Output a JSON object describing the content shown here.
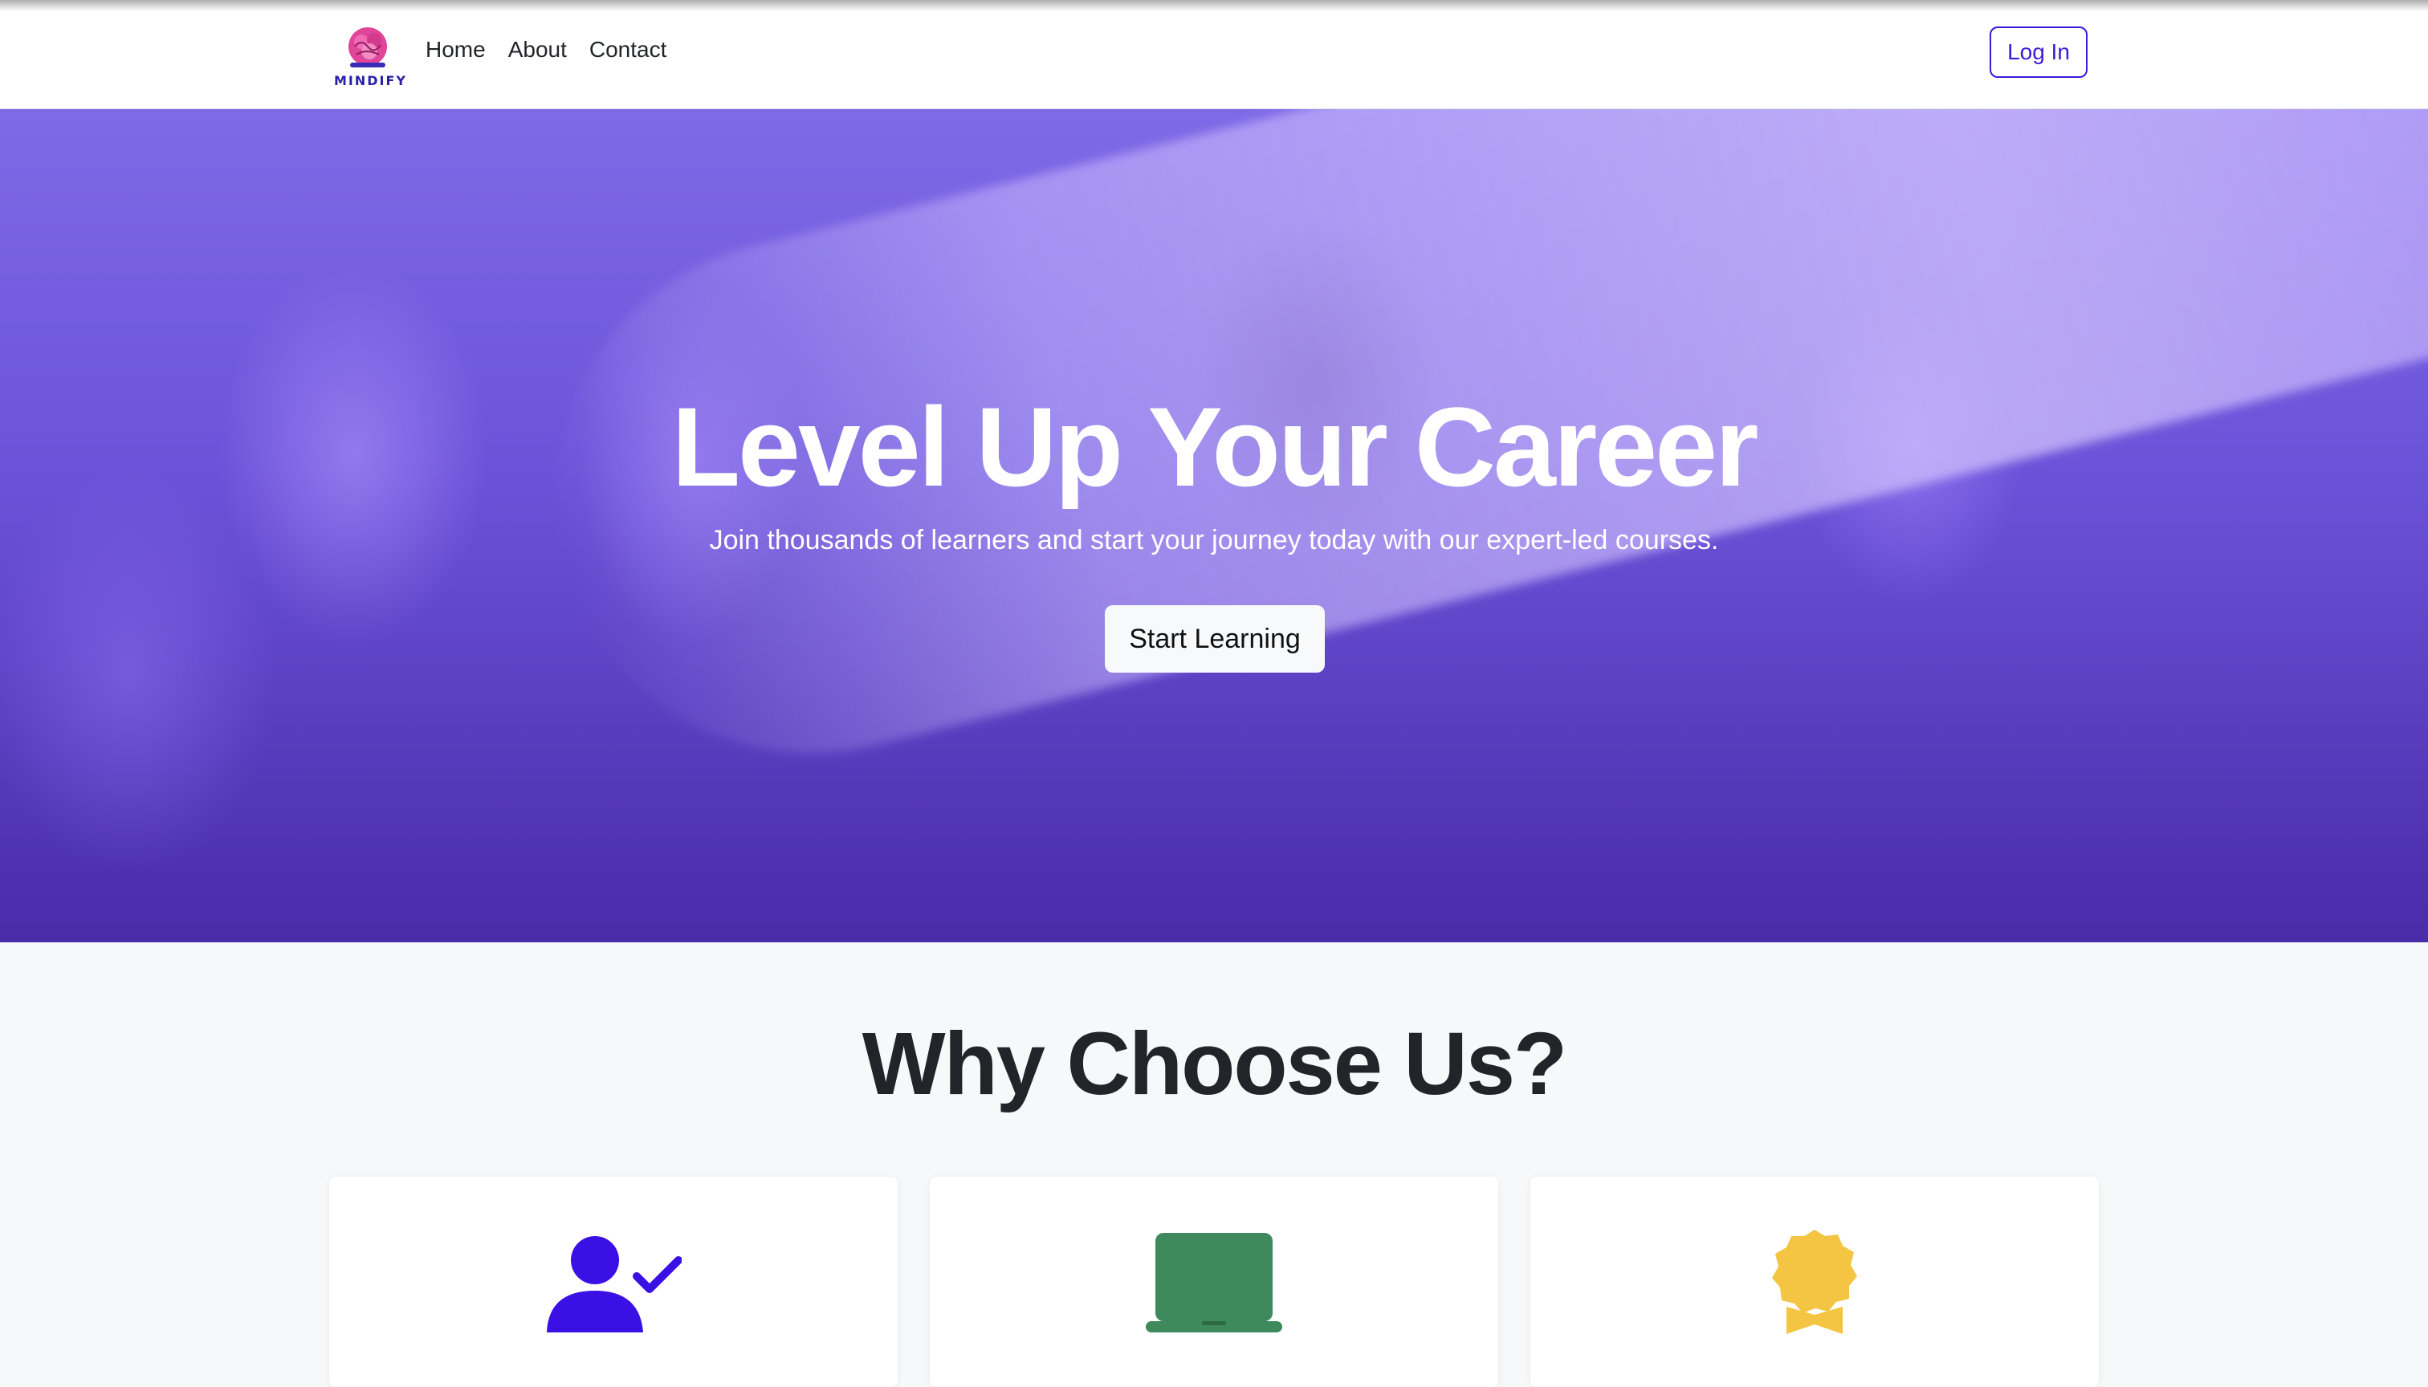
{
  "brand": {
    "name": "MINDIFY"
  },
  "nav": {
    "links": [
      "Home",
      "About",
      "Contact"
    ],
    "login_label": "Log In"
  },
  "hero": {
    "title": "Level Up Your Career",
    "subtitle": "Join thousands of learners and start your journey today with our expert-led courses.",
    "cta_label": "Start Learning"
  },
  "why": {
    "title": "Why Choose Us?",
    "cards": [
      {
        "icon": "user-check-icon",
        "color": "#3a10e5"
      },
      {
        "icon": "laptop-icon",
        "color": "#3f8a5c"
      },
      {
        "icon": "award-icon",
        "color": "#f4c542"
      }
    ]
  },
  "colors": {
    "accent": "#3b1ad6",
    "hero_overlay": "#6a52d8"
  }
}
